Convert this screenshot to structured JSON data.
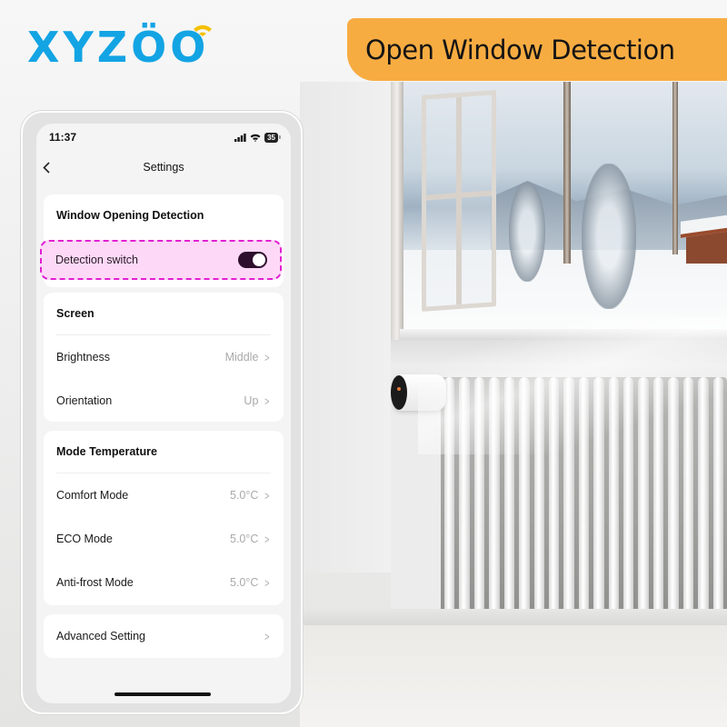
{
  "brand": {
    "logo_text": "XYZÖO",
    "logo_color": "#13a4e4",
    "wifi_accent_color": "#f5c000"
  },
  "banner": {
    "text": "Open Window Detection",
    "background_color": "#f7ac42"
  },
  "phone": {
    "status_bar": {
      "time": "11:37",
      "signal_icon": "cellular-signal-icon",
      "wifi_icon": "wifi-icon",
      "battery_level": "35"
    },
    "nav": {
      "back_icon": "chevron-left-icon",
      "title": "Settings"
    },
    "sections": {
      "window_detection": {
        "title": "Window Opening Detection",
        "detection_switch": {
          "label": "Detection switch",
          "state": "on",
          "highlight_color": "#e21fd3"
        }
      },
      "screen": {
        "title": "Screen",
        "rows": [
          {
            "label": "Brightness",
            "value": "Middle"
          },
          {
            "label": "Orientation",
            "value": "Up"
          }
        ]
      },
      "mode_temperature": {
        "title": "Mode Temperature",
        "rows": [
          {
            "label": "Comfort Mode",
            "value": "5.0°C"
          },
          {
            "label": "ECO Mode",
            "value": "5.0°C"
          },
          {
            "label": "Anti-frost Mode",
            "value": "5.0°C"
          }
        ]
      },
      "advanced": {
        "label": "Advanced Setting"
      }
    },
    "chevron_glyph": ">",
    "back_glyph": "<"
  },
  "scene": {
    "description": "Open window with snowy landscape above a white radiator fitted with a smart thermostat"
  }
}
